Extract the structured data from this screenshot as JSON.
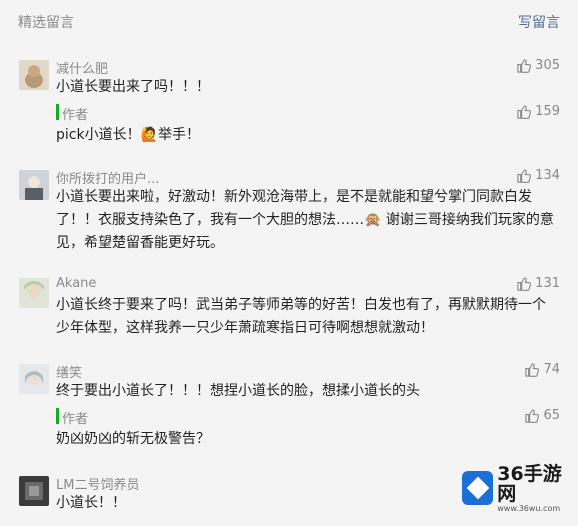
{
  "header": {
    "title": "精选留言",
    "write_label": "写留言"
  },
  "comments": [
    {
      "nick": "减什么肥",
      "text": "小道长要出来了吗！！！",
      "likes": "305",
      "reply": {
        "label": "作者",
        "text": "pick小道长！🙋举手！",
        "likes": "159"
      }
    },
    {
      "nick": "你所拨打的用户...",
      "text": "小道长要出来啦，好激动！新外观沧海带上，是不是就能和望兮掌门同款白发了！！衣服支持染色了，我有一个大胆的想法……🙊 谢谢三哥接纳我们玩家的意见，希望楚留香能更好玩。",
      "likes": "134"
    },
    {
      "nick": "Akane",
      "text": "小道长终于要来了吗！武当弟子等师弟等的好苦！白发也有了，再默默期待一个少年体型，这样我养一只少年萧疏寒指日可待啊想想就激动！",
      "likes": "131"
    },
    {
      "nick": "缮笑",
      "text": "终于要出小道长了！！！想捏小道长的脸，想揉小道长的头",
      "likes": "74",
      "reply": {
        "label": "作者",
        "text": "奶凶奶凶的斩无极警告？",
        "likes": "65"
      }
    },
    {
      "nick": "LM二号饲养员",
      "text": "小道长！！"
    }
  ],
  "watermark": {
    "name": "36手游网",
    "url": "www.36wu.com"
  }
}
